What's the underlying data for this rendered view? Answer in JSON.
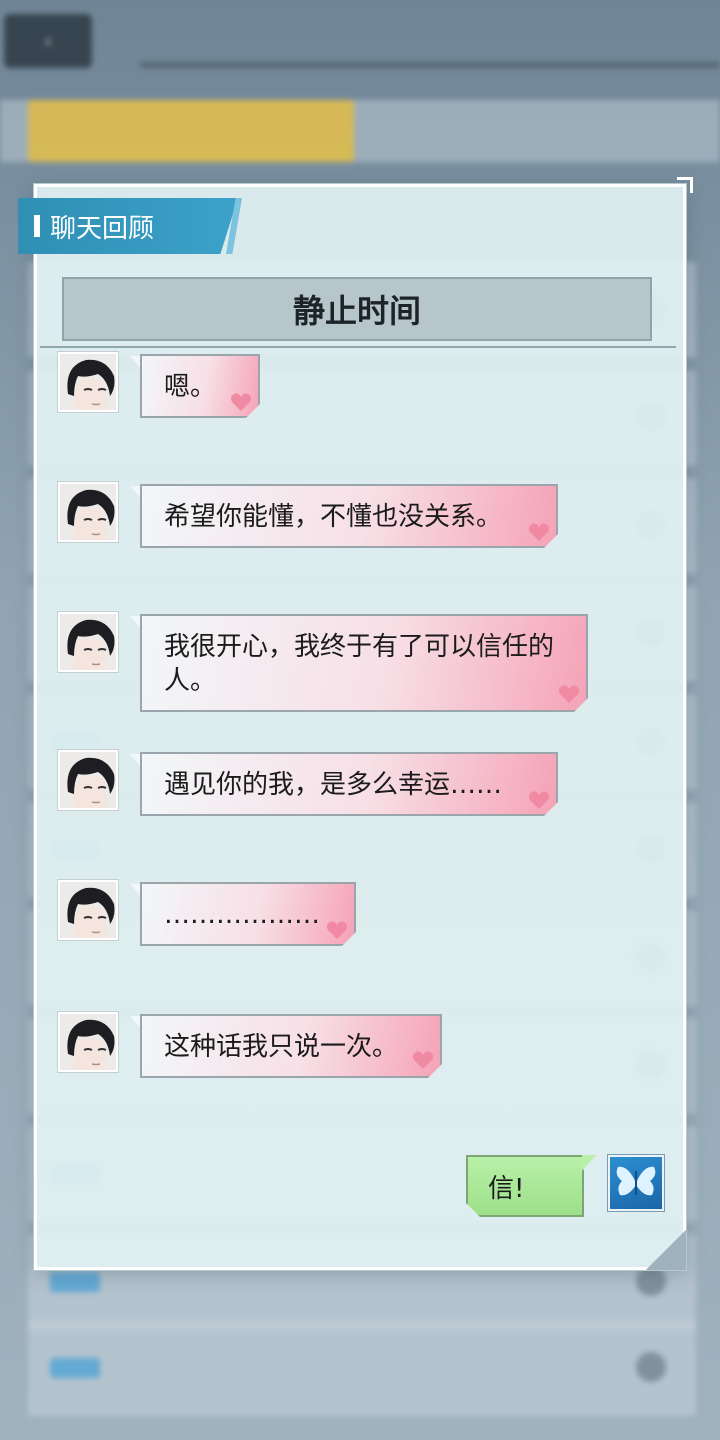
{
  "panel": {
    "header_label": "聊天回顾",
    "topic_title": "静止时间"
  },
  "messages": [
    {
      "text": "嗯。"
    },
    {
      "text": "希望你能懂，不懂也没关系。"
    },
    {
      "text": "我很开心，我终于有了可以信任的人。"
    },
    {
      "text": "遇见你的我，是多么幸运……"
    },
    {
      "text": "………………"
    },
    {
      "text": "这种话我只说一次。"
    }
  ],
  "reply": {
    "text": "信!"
  },
  "icons": {
    "avatar": "character-portrait-icon",
    "heart": "heart-icon",
    "player_avatar": "butterfly-icon"
  },
  "colors": {
    "header_accent": "#2f8fb4",
    "reply_bubble": "#a6e494",
    "heart": "#f08aa2"
  }
}
